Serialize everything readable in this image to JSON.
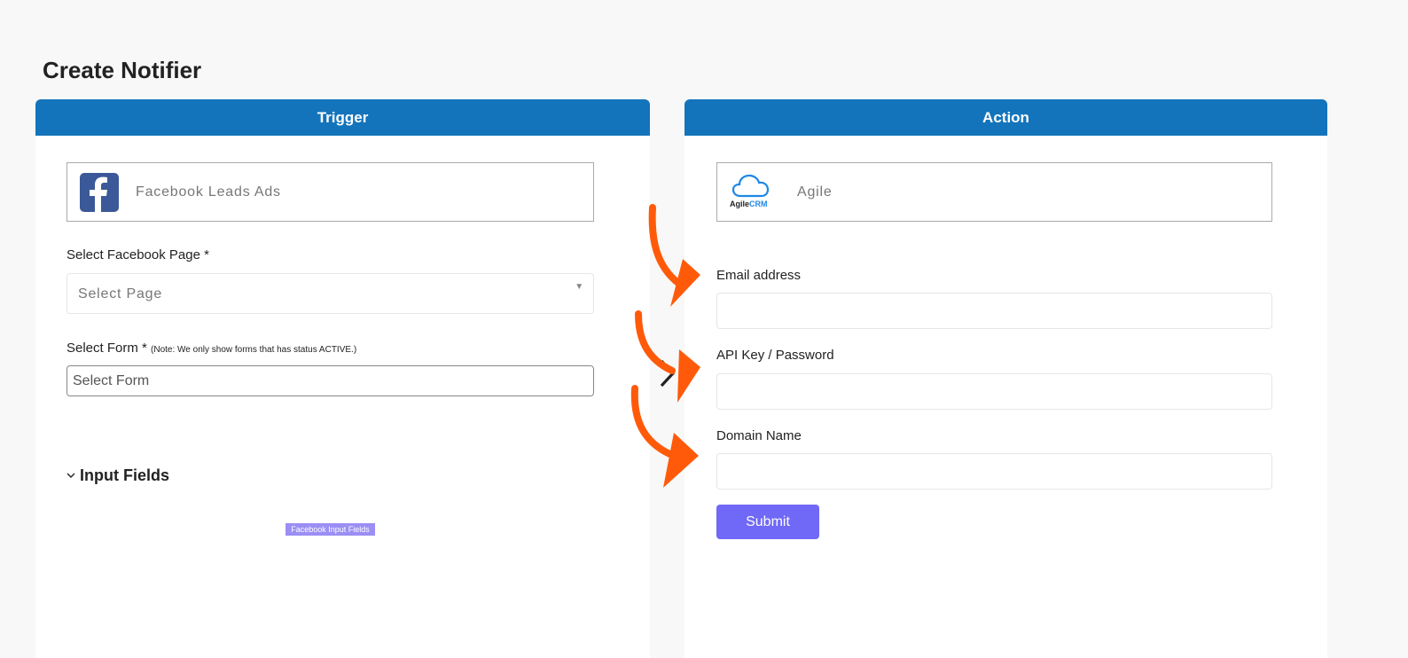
{
  "page": {
    "title": "Create Notifier"
  },
  "trigger": {
    "header": "Trigger",
    "app_name": "Facebook Leads Ads",
    "page_label": "Select Facebook Page *",
    "page_placeholder": "Select Page",
    "form_label": "Select Form *",
    "form_note": "(Note: We only show forms that has status ACTIVE.)",
    "form_placeholder": "Select Form",
    "input_fields_title": "Input Fields",
    "fb_fields_tag": "Facebook Input Fields"
  },
  "action": {
    "header": "Action",
    "app_name": "Agile",
    "logo_text_a": "Agile",
    "logo_text_b": "CRM",
    "email_label": "Email address",
    "api_label": "API Key / Password",
    "domain_label": "Domain Name",
    "submit_label": "Submit"
  },
  "colors": {
    "header_blue": "#1474bb",
    "submit_purple": "#7068f6",
    "arrow_orange": "#ff5a0a",
    "facebook_blue": "#3b5998"
  },
  "icons": [
    "facebook-logo-icon",
    "agile-crm-cloud-icon",
    "caret-down-icon",
    "chevron-down-icon",
    "chevron-right-icon",
    "orange-arrow-icon"
  ]
}
